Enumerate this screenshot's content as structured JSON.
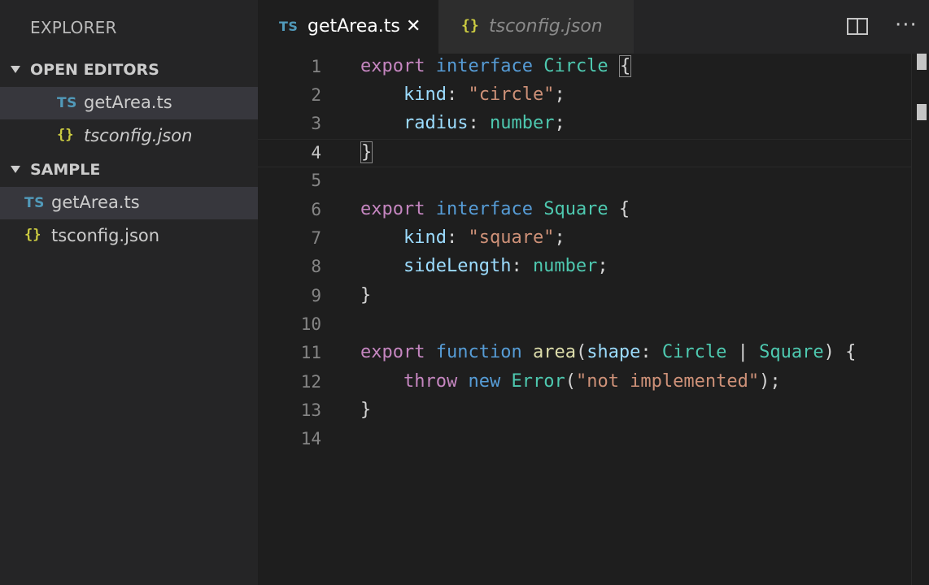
{
  "sidebar": {
    "title": "EXPLORER",
    "open_editors": {
      "label": "OPEN EDITORS",
      "items": [
        {
          "icon": "TS",
          "label": "getArea.ts"
        },
        {
          "icon": "{}",
          "label": "tsconfig.json"
        }
      ]
    },
    "sample": {
      "label": "SAMPLE",
      "items": [
        {
          "icon": "TS",
          "label": "getArea.ts"
        },
        {
          "icon": "{}",
          "label": "tsconfig.json"
        }
      ]
    }
  },
  "tabs": [
    {
      "icon": "TS",
      "label": "getArea.ts",
      "close": "✕"
    },
    {
      "icon": "{}",
      "label": "tsconfig.json"
    }
  ],
  "toolbar": {
    "split_icon": "split-editor-icon",
    "more_label": "···"
  },
  "editor": {
    "line_numbers": [
      "1",
      "2",
      "3",
      "4",
      "5",
      "6",
      "7",
      "8",
      "9",
      "10",
      "11",
      "12",
      "13",
      "14"
    ],
    "lines": [
      "export interface Circle {",
      "    kind: \"circle\";",
      "    radius: number;",
      "}",
      "",
      "export interface Square {",
      "    kind: \"square\";",
      "    sideLength: number;",
      "}",
      "",
      "export function area(shape: Circle | Square) {",
      "    throw new Error(\"not implemented\");",
      "}",
      ""
    ]
  },
  "colors": {
    "keyword": "#c586c0",
    "storage": "#569cd6",
    "type": "#4ec9b0",
    "property": "#9cdcfe",
    "string": "#ce9178",
    "function": "#dcdcaa",
    "ts_icon": "#519aba",
    "json_icon": "#cbcb41"
  }
}
